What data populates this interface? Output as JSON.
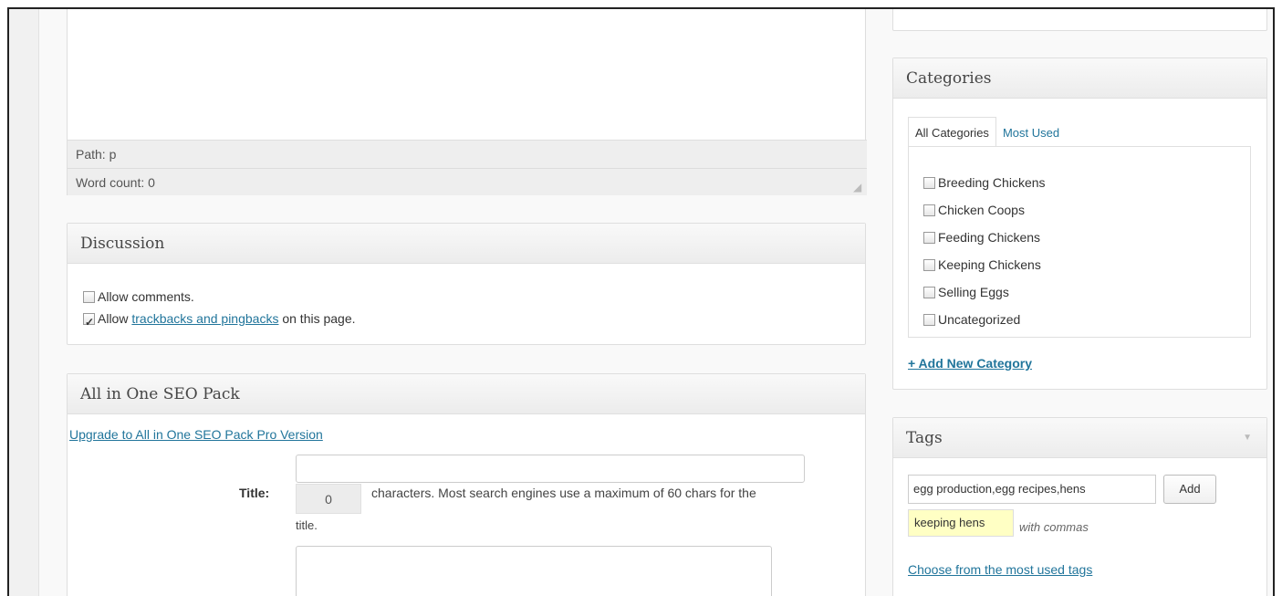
{
  "editor": {
    "path": "Path: p",
    "word_count": "Word count: 0"
  },
  "discussion": {
    "title": "Discussion",
    "allow_comments": "Allow comments.",
    "allow_trackbacks_prefix": "Allow ",
    "allow_trackbacks_link": "trackbacks and pingbacks",
    "allow_trackbacks_suffix": " on this page.",
    "allow_comments_checked": false,
    "allow_trackbacks_checked": true
  },
  "seo": {
    "title": "All in One SEO Pack",
    "upgrade_link": "Upgrade to All in One SEO Pack Pro Version",
    "title_label": "Title:",
    "title_value": "",
    "char_count": "0",
    "char_note": "characters. Most search engines use a maximum of 60 chars for the",
    "char_note_cont": "title."
  },
  "categories": {
    "title": "Categories",
    "tab_all": "All Categories",
    "tab_most_used": "Most Used",
    "items": [
      {
        "label": "Breeding Chickens",
        "checked": false
      },
      {
        "label": "Chicken Coops",
        "checked": false
      },
      {
        "label": "Feeding Chickens",
        "checked": false
      },
      {
        "label": "Keeping Chickens",
        "checked": false
      },
      {
        "label": "Selling Eggs",
        "checked": false
      },
      {
        "label": "Uncategorized",
        "checked": false
      }
    ],
    "add_new": "+ Add New Category"
  },
  "tags": {
    "title": "Tags",
    "input_value": "egg production,egg recipes,hens",
    "add_label": "Add",
    "suggestion": "keeping hens",
    "hint": "with commas",
    "choose_link": "Choose from the most used tags"
  }
}
